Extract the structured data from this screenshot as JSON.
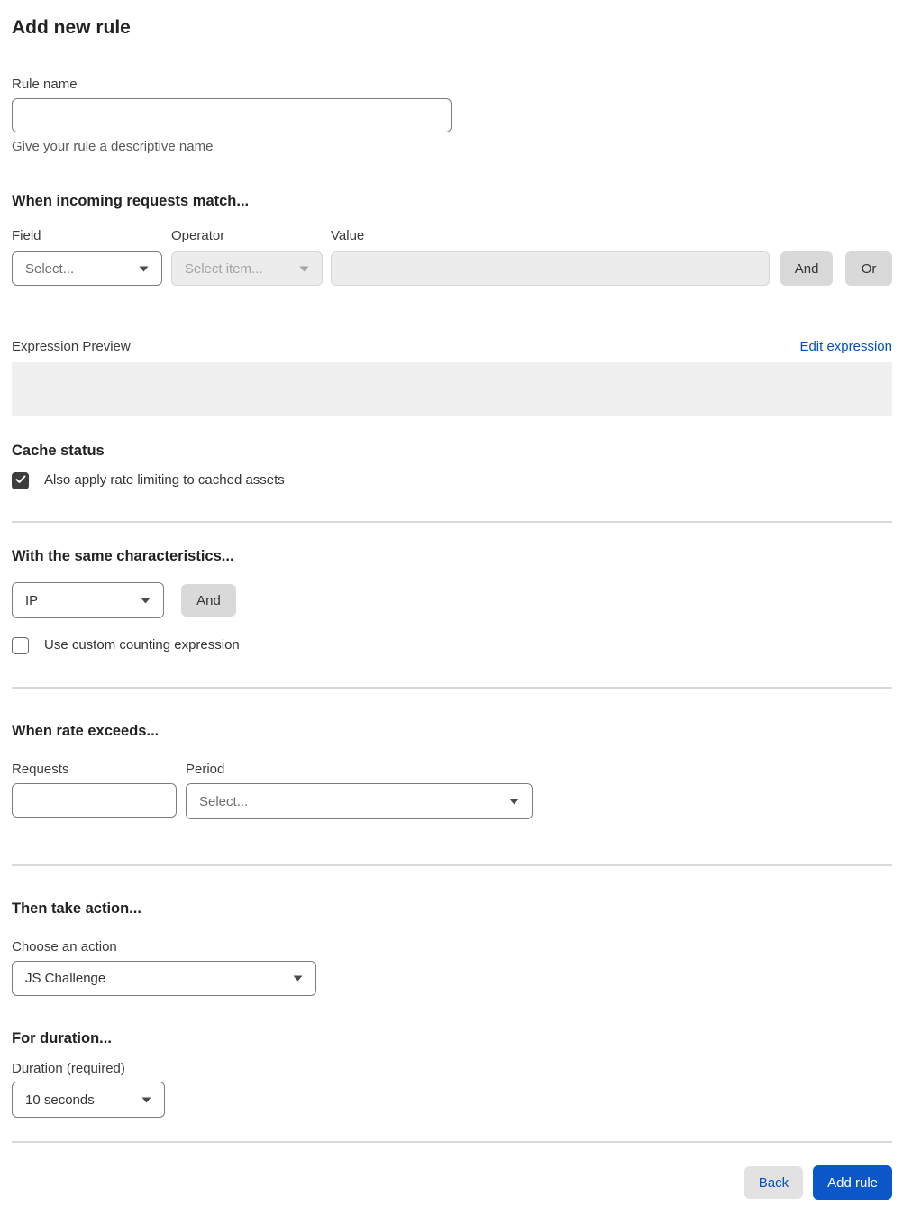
{
  "page": {
    "title": "Add new rule"
  },
  "rule_name": {
    "label": "Rule name",
    "value": "",
    "placeholder": "",
    "helper": "Give your rule a descriptive name"
  },
  "match_section": {
    "heading": "When incoming requests match...",
    "field": {
      "label": "Field",
      "selected": "Select..."
    },
    "operator": {
      "label": "Operator",
      "selected": "Select item...",
      "disabled": true
    },
    "value": {
      "label": "Value",
      "value": "",
      "disabled": true
    },
    "and_button": "And",
    "or_button": "Or"
  },
  "expression_section": {
    "label": "Expression Preview",
    "edit_link": "Edit expression",
    "preview_value": ""
  },
  "cache_section": {
    "heading": "Cache status",
    "checkbox_label": "Also apply rate limiting to cached assets",
    "checked": true
  },
  "characteristics_section": {
    "heading": "With the same characteristics...",
    "characteristic_selected": "IP",
    "and_button": "And",
    "custom_counting_label": "Use custom counting expression",
    "custom_counting_checked": false
  },
  "rate_section": {
    "heading": "When rate exceeds...",
    "requests": {
      "label": "Requests",
      "value": ""
    },
    "period": {
      "label": "Period",
      "selected": "Select..."
    }
  },
  "action_section": {
    "heading": "Then take action...",
    "label": "Choose an action",
    "selected": "JS Challenge"
  },
  "duration_section": {
    "heading": "For duration...",
    "label": "Duration (required)",
    "selected": "10 seconds"
  },
  "footer": {
    "back_button": "Back",
    "add_button": "Add rule"
  },
  "icons": {
    "chevron_down": "▾",
    "check": "✓"
  },
  "colors": {
    "primary_button": "#0b57c9",
    "link": "#0051c3",
    "chip_button": "#d9d9d9",
    "disabled_fill": "#ececec",
    "preview_fill": "#f0f0f0",
    "divider": "#d9d9d9",
    "checkbox_checked": "#3d3d3d"
  }
}
